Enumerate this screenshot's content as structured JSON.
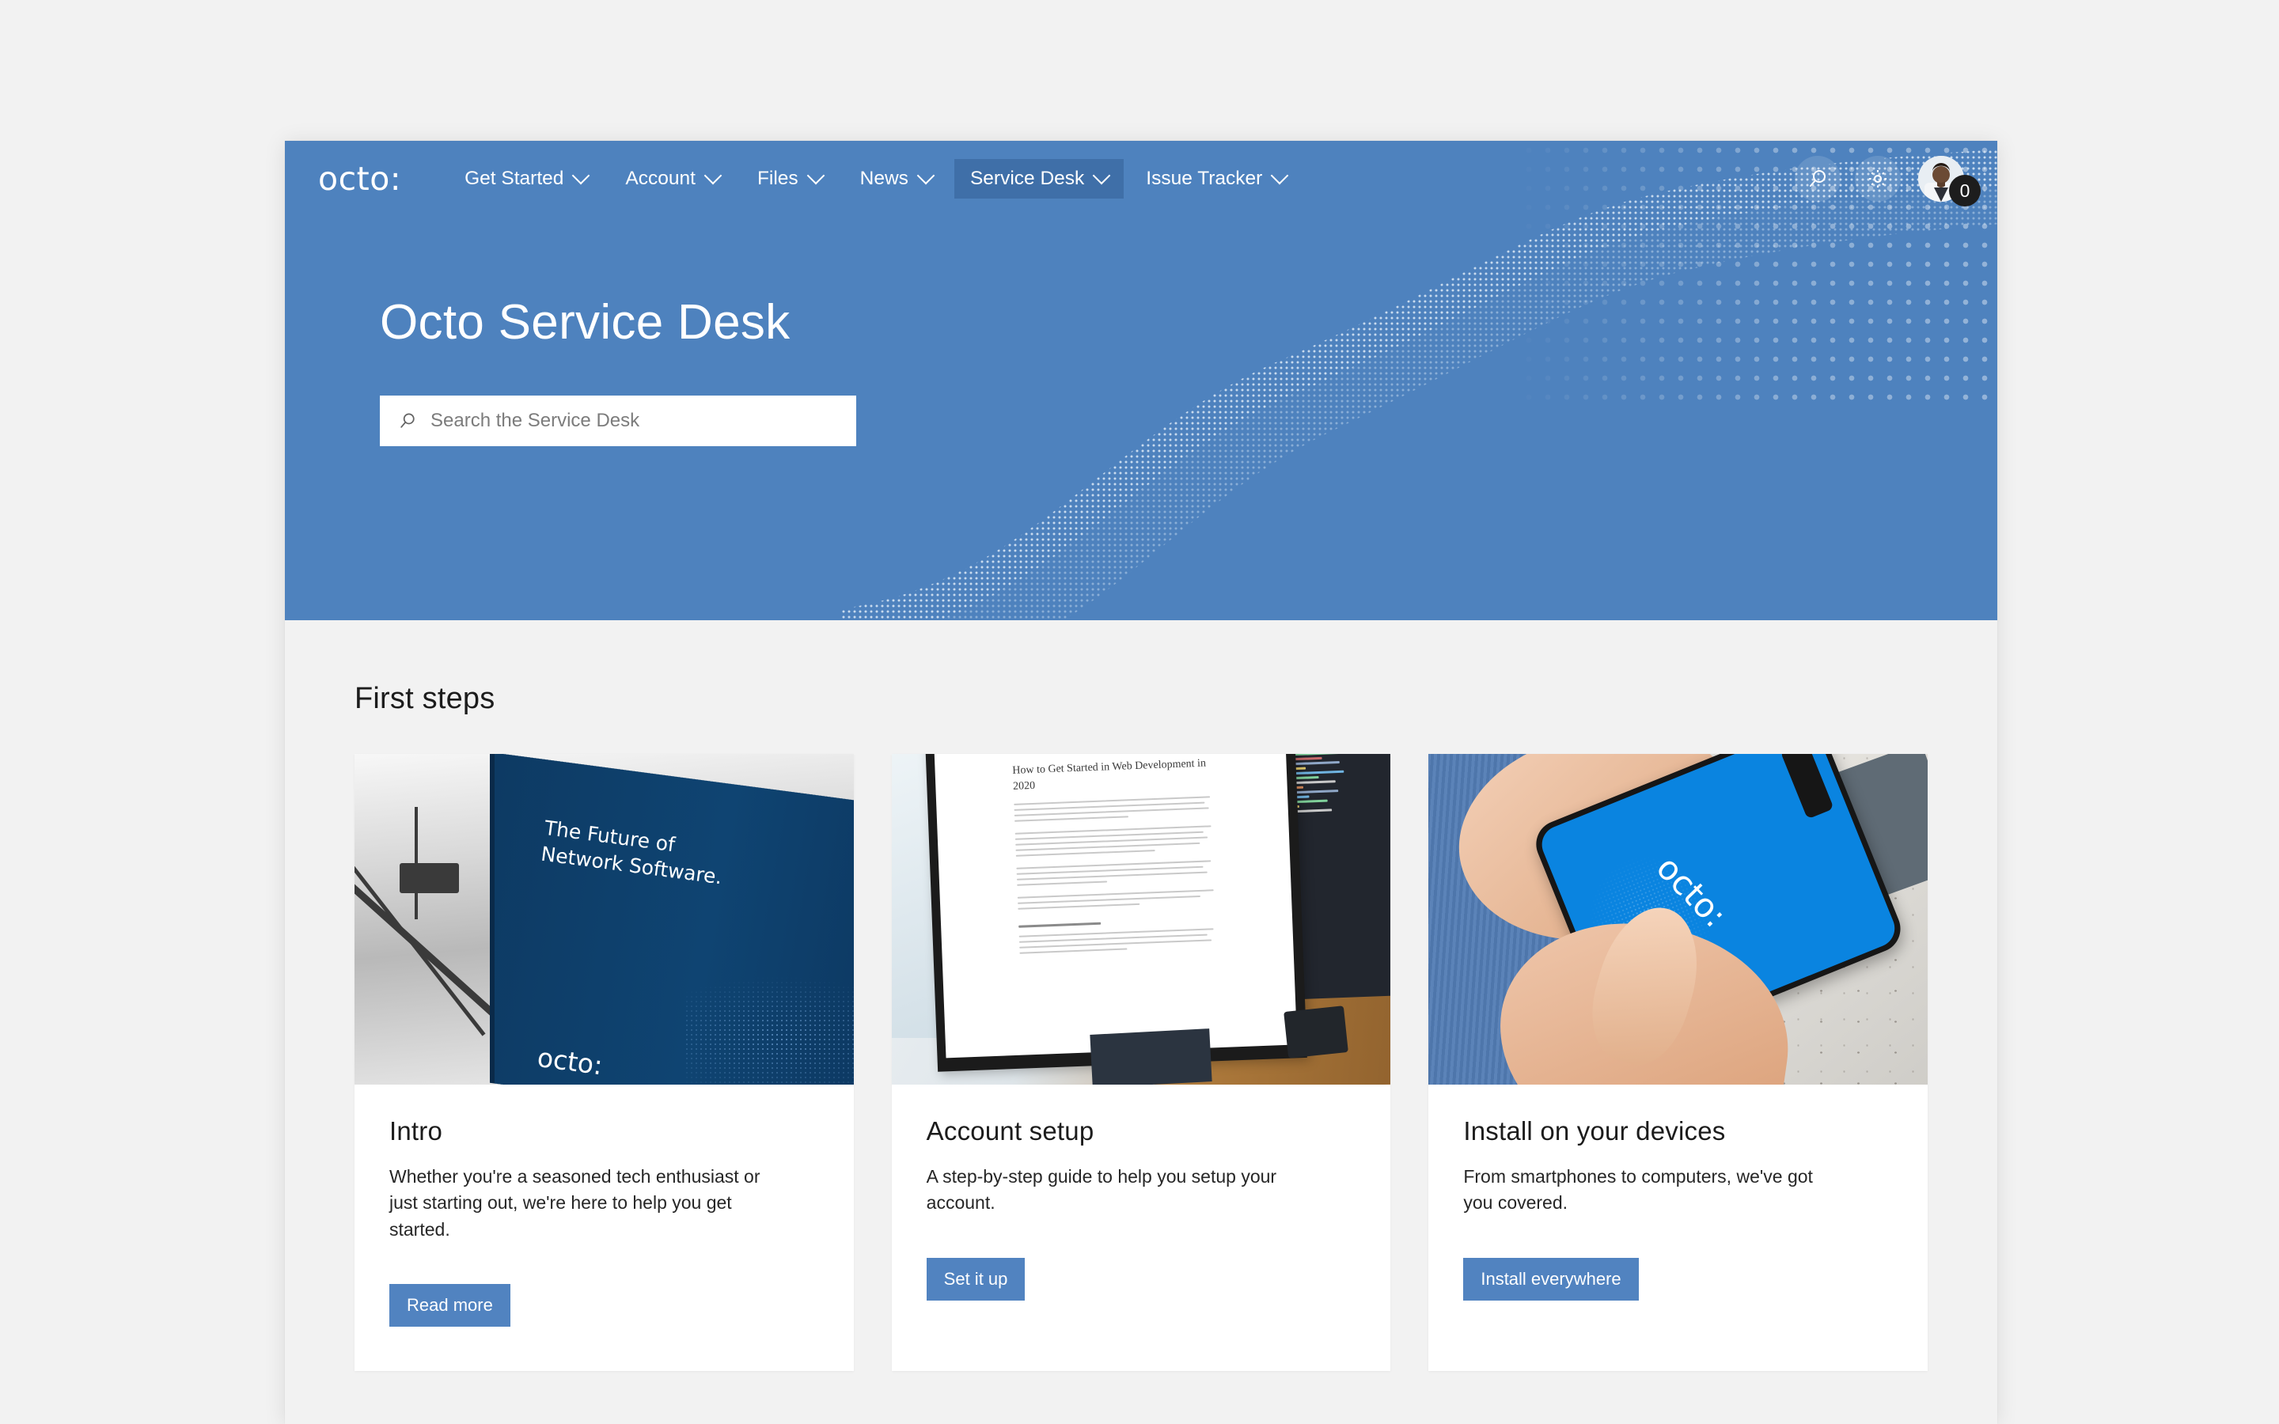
{
  "brand": {
    "logo_text": "octo:"
  },
  "nav": {
    "items": [
      {
        "label": "Get Started",
        "has_chevron": true,
        "active": false
      },
      {
        "label": "Account",
        "has_chevron": true,
        "active": false
      },
      {
        "label": "Files",
        "has_chevron": true,
        "active": false
      },
      {
        "label": "News",
        "has_chevron": true,
        "active": false
      },
      {
        "label": "Service Desk",
        "has_chevron": true,
        "active": true
      },
      {
        "label": "Issue Tracker",
        "has_chevron": true,
        "active": false
      }
    ],
    "actions": {
      "search_icon": "search-icon",
      "settings_icon": "gear-icon",
      "avatar": "avatar",
      "notification_count": "0"
    }
  },
  "hero": {
    "title": "Octo Service Desk",
    "search": {
      "placeholder": "Search the Service Desk",
      "value": "",
      "icon": "search-icon"
    },
    "background_color": "#4e82be",
    "decoration": "dot-wave-pattern"
  },
  "content": {
    "section_title": "First steps",
    "cards": [
      {
        "title": "Intro",
        "description": "Whether you're a seasoned tech enthusiast or just starting out, we're here to help you get started.",
        "button_label": "Read more",
        "image_alt": "trade-show banner reading The Future of Network Software with octo: logo",
        "banner_line1": "The Future of",
        "banner_line2": "Network Software.",
        "banner_logo": "octo:"
      },
      {
        "title": "Account setup",
        "description": "A step-by-step guide to help you setup your account.",
        "button_label": "Set it up",
        "image_alt": "desktop monitor showing an article titled How to Get Started in Web Development in 2020",
        "article_title": "How to Get Started in Web Development in 2020"
      },
      {
        "title": "Install on your devices",
        "description": "From smartphones to computers, we've got you covered.",
        "button_label": "Install everywhere",
        "image_alt": "hands holding a smartphone showing the octo: splash screen",
        "phone_logo": "octo:"
      }
    ]
  },
  "colors": {
    "hero_blue": "#4e82be",
    "nav_active": "#3f6fa8",
    "button_blue": "#5183c0",
    "page_bg": "#f2f2f2",
    "card_bg": "#ffffff",
    "badge_bg": "#1d1d1d"
  }
}
